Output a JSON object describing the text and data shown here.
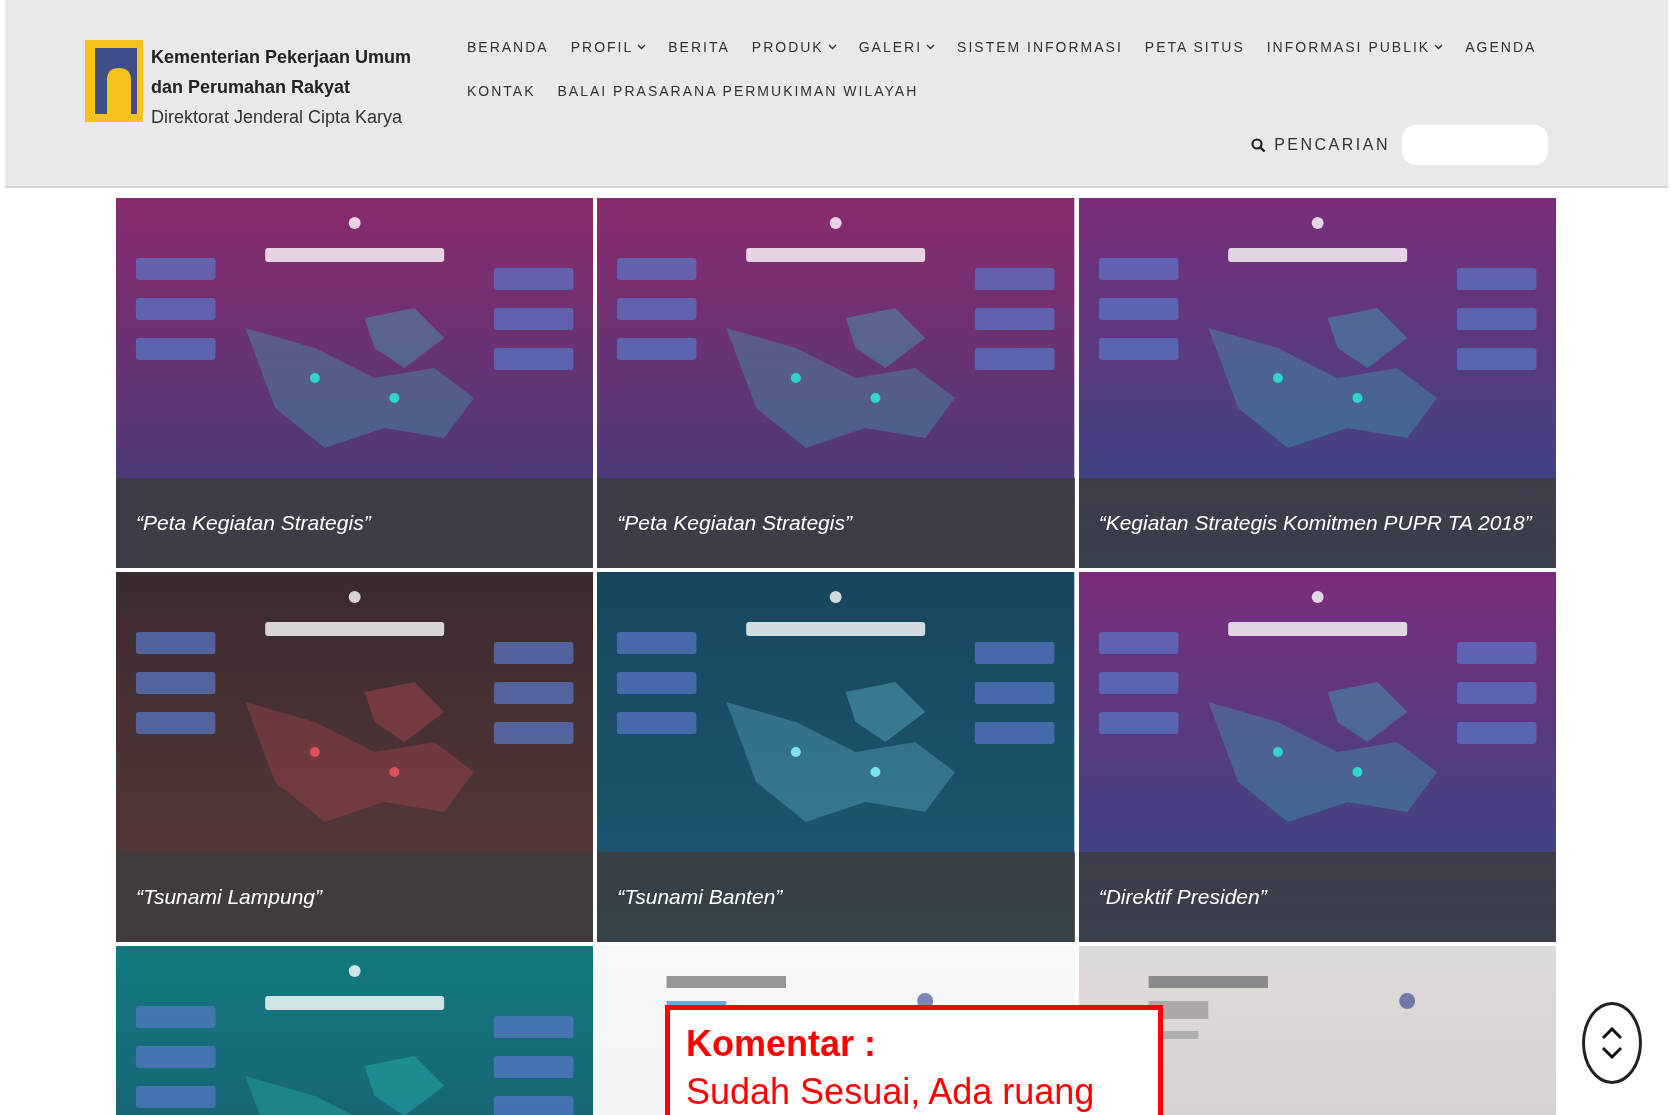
{
  "header": {
    "logo": {
      "line1": "Kementerian Pekerjaan Umum",
      "line2": "dan Perumahan Rakyat",
      "line3": "Direktorat Jenderal Cipta Karya"
    },
    "nav_rows": [
      [
        {
          "label": "BERANDA",
          "dropdown": false
        },
        {
          "label": "PROFIL",
          "dropdown": true
        },
        {
          "label": "BERITA",
          "dropdown": false
        },
        {
          "label": "PRODUK",
          "dropdown": true
        },
        {
          "label": "GALERI",
          "dropdown": true
        },
        {
          "label": "SISTEM INFORMASI",
          "dropdown": false
        },
        {
          "label": "PETA SITUS",
          "dropdown": false
        },
        {
          "label": "INFORMASI PUBLIK",
          "dropdown": true
        },
        {
          "label": "AGENDA",
          "dropdown": false
        }
      ],
      [
        {
          "label": "KONTAK",
          "dropdown": false
        },
        {
          "label": "BALAI PRASARANA PERMUKIMAN WILAYAH",
          "dropdown": false
        }
      ]
    ],
    "search": {
      "label": "PENCARIAN"
    }
  },
  "gallery": [
    {
      "kind": "captioned",
      "caption": "“Peta Kegiatan Strategis”"
    },
    {
      "kind": "captioned",
      "caption": "“Peta Kegiatan Strategis”"
    },
    {
      "kind": "captioned",
      "caption": "“Kegiatan Strategis Komitmen PUPR TA 2018”"
    },
    {
      "kind": "captioned",
      "caption": "“Tsunami Lampung”"
    },
    {
      "kind": "captioned",
      "caption": "“Tsunami Banten”"
    },
    {
      "kind": "captioned",
      "caption": "“Direktif Presiden”"
    },
    {
      "kind": "picture"
    },
    {
      "kind": "picture"
    },
    {
      "kind": "picture"
    }
  ],
  "comment": {
    "title": "Komentar :",
    "text": "Sudah Sesuai, Ada ruang"
  }
}
